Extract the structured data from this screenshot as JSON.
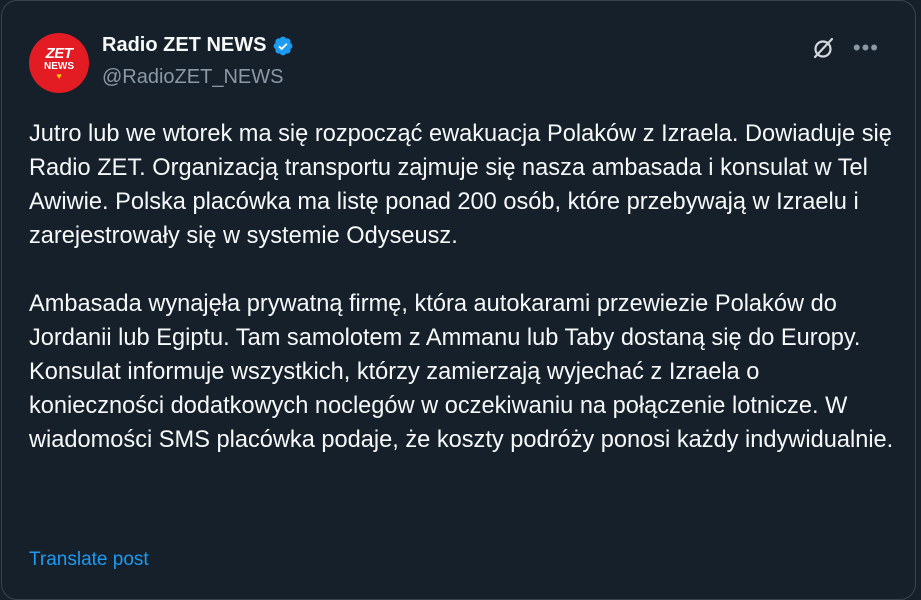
{
  "author": {
    "display_name": "Radio ZET NEWS",
    "handle": "@RadioZET_NEWS",
    "avatar": {
      "logo_text": "ZET",
      "logo_subtext": "NEWS",
      "background": "#e31b23"
    },
    "verified_color": "#1d9bf0"
  },
  "icons": {
    "grok": "grok-icon",
    "more": "more-horizontal-icon",
    "verified": "verified-badge-icon"
  },
  "post": {
    "paragraph_1": "Jutro lub we wtorek ma się rozpocząć ewakuacja Polaków z Izraela. Dowiaduje się Radio ZET. Organizacją transportu zajmuje się nasza ambasada i konsulat w Tel Awiwie. Polska placówka ma listę ponad 200 osób, które przebywają w Izraelu i zarejestrowały się w systemie Odyseusz.",
    "paragraph_2": "Ambasada wynajęła prywatną firmę, która autokarami przewiezie Polaków do Jordanii lub Egiptu. Tam samolotem z Ammanu lub Taby dostaną się do Europy. Konsulat informuje wszystkich, którzy zamierzają wyjechać z Izraela o konieczności dodatkowych noclegów w oczekiwaniu na połączenie lotnicze. W wiadomości SMS placówka podaje, że koszty podróży ponosi każdy indywidualnie."
  },
  "translate_label": "Translate post",
  "colors": {
    "background": "#15202b",
    "text": "#f7f9f9",
    "secondary_text": "#8b98a5",
    "link": "#1d9bf0"
  }
}
